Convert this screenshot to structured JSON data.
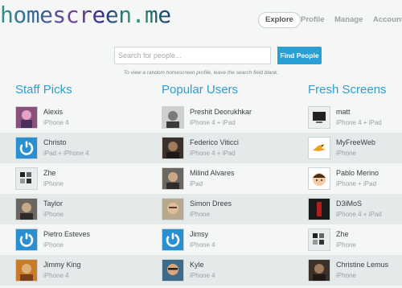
{
  "logo": "homescreen.me",
  "nav": [
    {
      "label": "Explore",
      "active": true
    },
    {
      "label": "Profile",
      "active": false
    },
    {
      "label": "Manage",
      "active": false
    },
    {
      "label": "Account",
      "active": false
    }
  ],
  "search": {
    "placeholder": "Search for people...",
    "value": "",
    "button_label": "Find People",
    "hint": "To view a random homescreen profile, leave the search field blank."
  },
  "columns": [
    {
      "title": "Staff Picks",
      "users": [
        {
          "name": "Alexis",
          "device": "iPhone 4",
          "avatar": "photo-pink"
        },
        {
          "name": "Christo",
          "device": "iPad + iPhone 4",
          "avatar": "power-icon"
        },
        {
          "name": "Zhe",
          "device": "iPhone",
          "avatar": "photo-grid"
        },
        {
          "name": "Taylor",
          "device": "iPhone",
          "avatar": "photo-portrait"
        },
        {
          "name": "Pietro Esteves",
          "device": "iPhone",
          "avatar": "power-icon"
        },
        {
          "name": "Jimmy King",
          "device": "iPhone 4",
          "avatar": "photo-orange"
        }
      ]
    },
    {
      "title": "Popular Users",
      "users": [
        {
          "name": "Preshit Deorukhkar",
          "device": "iPhone 4 + iPad",
          "avatar": "photo-bw"
        },
        {
          "name": "Federico Viticci",
          "device": "iPhone 4 + iPad",
          "avatar": "photo-dark"
        },
        {
          "name": "Milind Alvares",
          "device": "iPad",
          "avatar": "photo-portrait"
        },
        {
          "name": "Simon Drees",
          "device": "iPhone",
          "avatar": "photo-face"
        },
        {
          "name": "Jimsy",
          "device": "iPhone 4",
          "avatar": "power-icon"
        },
        {
          "name": "Kyle",
          "device": "iPhone 4",
          "avatar": "photo-glasses"
        }
      ]
    },
    {
      "title": "Fresh Screens",
      "users": [
        {
          "name": "matt",
          "device": "iPhone 4 + iPad",
          "avatar": "photo-computer"
        },
        {
          "name": "MyFreeWeb",
          "device": "iPhone",
          "avatar": "bird-icon"
        },
        {
          "name": "Pablo Merino",
          "device": "iPhone + iPad",
          "avatar": "cartoon-face"
        },
        {
          "name": "D3iMoS",
          "device": "iPhone 4 + iPad",
          "avatar": "photo-red"
        },
        {
          "name": "Zhe",
          "device": "iPhone",
          "avatar": "photo-grid"
        },
        {
          "name": "Christine Lemus",
          "device": "iPhone",
          "avatar": "photo-dark"
        }
      ]
    }
  ],
  "colors": {
    "accent": "#2a9fd3",
    "row_alt": "#e4e9ea",
    "power_blue": "#2a8fd0"
  }
}
